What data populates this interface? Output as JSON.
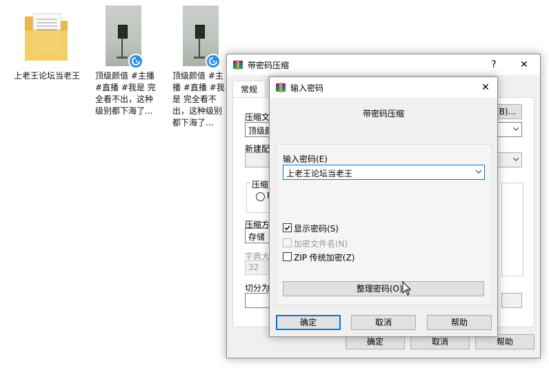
{
  "desktop": {
    "icons": [
      {
        "label": "上老王论坛当老王",
        "icon": "folder-icon"
      },
      {
        "label": "顶级颜值 #主播 #直播 #我是 完全看不出，这种级别都下海了...",
        "icon": "video-thumbnail"
      },
      {
        "label": "顶级颜值 #主播 #直播 #我是 完全看不出，这种级别都下海了...",
        "icon": "video-thumbnail"
      }
    ]
  },
  "back_dialog": {
    "title": "带密码压缩",
    "help": "?",
    "close": "✕",
    "tab_general": "常规",
    "label_archive_name": "压缩文",
    "archive_name_value": "顶级颜",
    "browse_label": "(B)...",
    "label_profile": "新建配",
    "label_format": "压缩",
    "radio_label": "R",
    "label_method": "压缩方",
    "method_value": "存储",
    "label_dict": "字典大",
    "dict_value": "32",
    "label_split": "切分为",
    "ok": "确定",
    "cancel": "取消",
    "help_button": "帮助"
  },
  "front_dialog": {
    "title": "输入密码",
    "close": "✕",
    "heading": "带密码压缩",
    "password_label": "输入密码(E)",
    "password_value": "上老王论坛当老王",
    "show_password": "显示密码(S)",
    "show_password_checked": true,
    "encrypt_names": "加密文件名(N)",
    "encrypt_names_enabled": false,
    "zip_legacy": "ZIP 传统加密(Z)",
    "zip_legacy_checked": false,
    "organize_button": "整理密码(O)...",
    "ok": "确定",
    "cancel": "取消",
    "help_button": "帮助"
  },
  "colors": {
    "accent": "#0078d7",
    "dialog_bg": "#f0f0f0",
    "badge": "#2d8ee6"
  }
}
